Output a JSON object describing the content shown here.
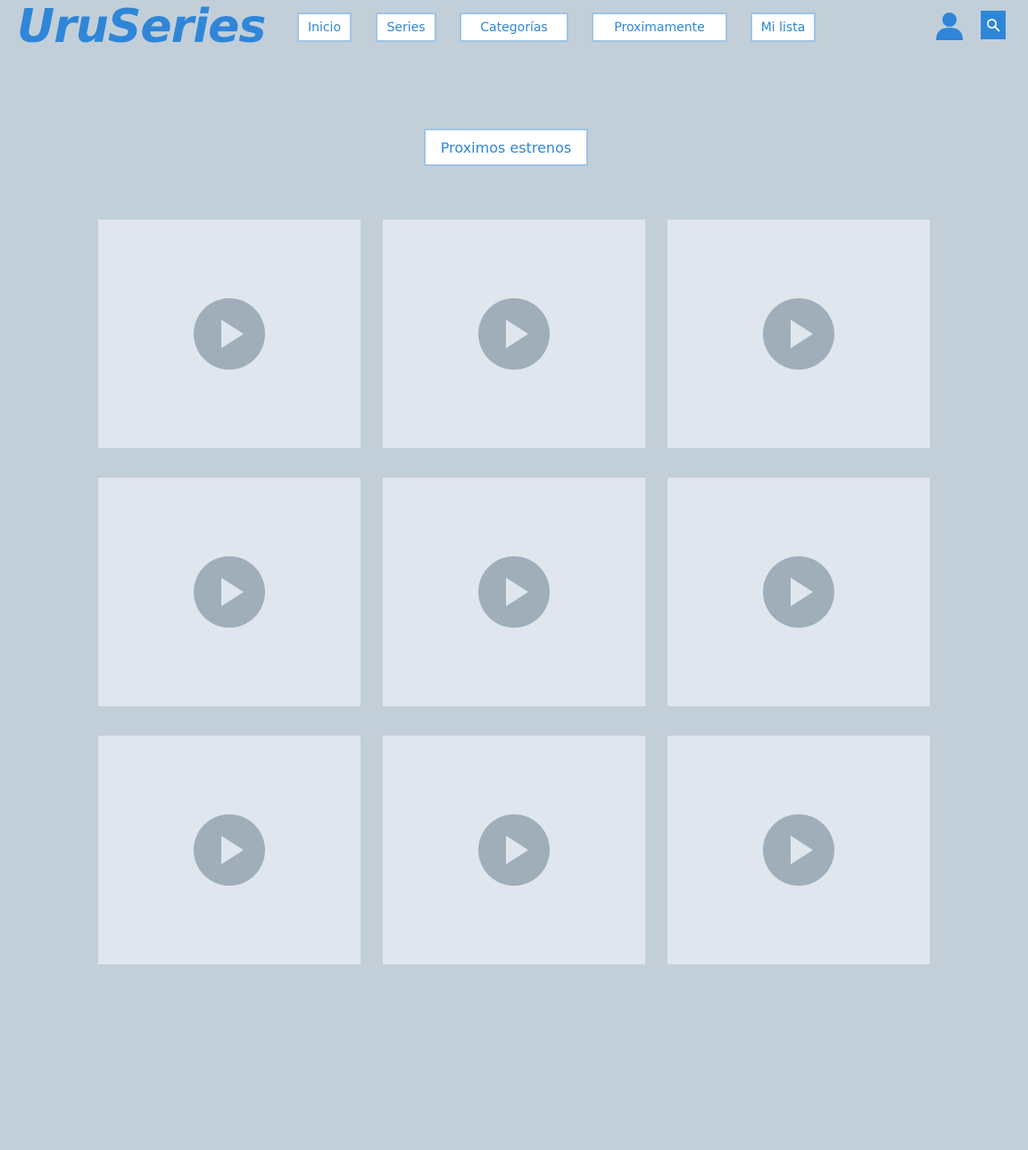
{
  "header": {
    "logo": "UruSeries",
    "nav": [
      {
        "label": "Inicio"
      },
      {
        "label": "Series"
      },
      {
        "label": "Categorías"
      },
      {
        "label": "Proximamente"
      },
      {
        "label": "Mi lista"
      }
    ],
    "icons": {
      "user": "user-icon",
      "search": "search-icon"
    }
  },
  "main": {
    "section_title": "Proximos estrenos",
    "card_count": 9,
    "card_icon": "play-icon"
  },
  "colors": {
    "background": "#c2cfd9",
    "accent": "#2f86d8",
    "card": "#dfe6ee",
    "play": "#a0aeba"
  }
}
